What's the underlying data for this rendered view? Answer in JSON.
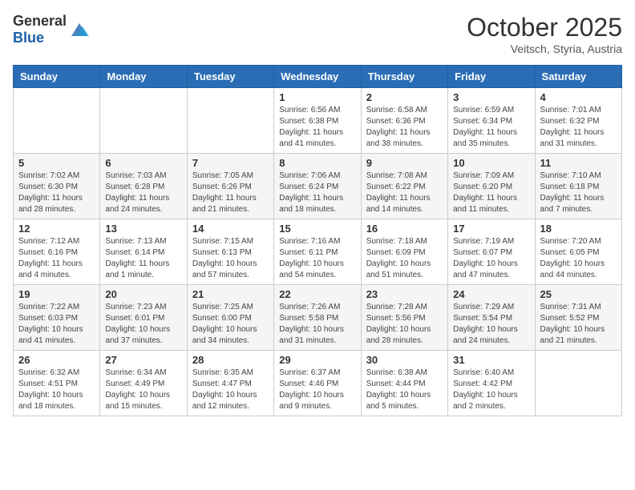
{
  "header": {
    "logo_general": "General",
    "logo_blue": "Blue",
    "month": "October 2025",
    "location": "Veitsch, Styria, Austria"
  },
  "weekdays": [
    "Sunday",
    "Monday",
    "Tuesday",
    "Wednesday",
    "Thursday",
    "Friday",
    "Saturday"
  ],
  "weeks": [
    [
      {
        "day": "",
        "info": ""
      },
      {
        "day": "",
        "info": ""
      },
      {
        "day": "",
        "info": ""
      },
      {
        "day": "1",
        "info": "Sunrise: 6:56 AM\nSunset: 6:38 PM\nDaylight: 11 hours\nand 41 minutes."
      },
      {
        "day": "2",
        "info": "Sunrise: 6:58 AM\nSunset: 6:36 PM\nDaylight: 11 hours\nand 38 minutes."
      },
      {
        "day": "3",
        "info": "Sunrise: 6:59 AM\nSunset: 6:34 PM\nDaylight: 11 hours\nand 35 minutes."
      },
      {
        "day": "4",
        "info": "Sunrise: 7:01 AM\nSunset: 6:32 PM\nDaylight: 11 hours\nand 31 minutes."
      }
    ],
    [
      {
        "day": "5",
        "info": "Sunrise: 7:02 AM\nSunset: 6:30 PM\nDaylight: 11 hours\nand 28 minutes."
      },
      {
        "day": "6",
        "info": "Sunrise: 7:03 AM\nSunset: 6:28 PM\nDaylight: 11 hours\nand 24 minutes."
      },
      {
        "day": "7",
        "info": "Sunrise: 7:05 AM\nSunset: 6:26 PM\nDaylight: 11 hours\nand 21 minutes."
      },
      {
        "day": "8",
        "info": "Sunrise: 7:06 AM\nSunset: 6:24 PM\nDaylight: 11 hours\nand 18 minutes."
      },
      {
        "day": "9",
        "info": "Sunrise: 7:08 AM\nSunset: 6:22 PM\nDaylight: 11 hours\nand 14 minutes."
      },
      {
        "day": "10",
        "info": "Sunrise: 7:09 AM\nSunset: 6:20 PM\nDaylight: 11 hours\nand 11 minutes."
      },
      {
        "day": "11",
        "info": "Sunrise: 7:10 AM\nSunset: 6:18 PM\nDaylight: 11 hours\nand 7 minutes."
      }
    ],
    [
      {
        "day": "12",
        "info": "Sunrise: 7:12 AM\nSunset: 6:16 PM\nDaylight: 11 hours\nand 4 minutes."
      },
      {
        "day": "13",
        "info": "Sunrise: 7:13 AM\nSunset: 6:14 PM\nDaylight: 11 hours\nand 1 minute."
      },
      {
        "day": "14",
        "info": "Sunrise: 7:15 AM\nSunset: 6:13 PM\nDaylight: 10 hours\nand 57 minutes."
      },
      {
        "day": "15",
        "info": "Sunrise: 7:16 AM\nSunset: 6:11 PM\nDaylight: 10 hours\nand 54 minutes."
      },
      {
        "day": "16",
        "info": "Sunrise: 7:18 AM\nSunset: 6:09 PM\nDaylight: 10 hours\nand 51 minutes."
      },
      {
        "day": "17",
        "info": "Sunrise: 7:19 AM\nSunset: 6:07 PM\nDaylight: 10 hours\nand 47 minutes."
      },
      {
        "day": "18",
        "info": "Sunrise: 7:20 AM\nSunset: 6:05 PM\nDaylight: 10 hours\nand 44 minutes."
      }
    ],
    [
      {
        "day": "19",
        "info": "Sunrise: 7:22 AM\nSunset: 6:03 PM\nDaylight: 10 hours\nand 41 minutes."
      },
      {
        "day": "20",
        "info": "Sunrise: 7:23 AM\nSunset: 6:01 PM\nDaylight: 10 hours\nand 37 minutes."
      },
      {
        "day": "21",
        "info": "Sunrise: 7:25 AM\nSunset: 6:00 PM\nDaylight: 10 hours\nand 34 minutes."
      },
      {
        "day": "22",
        "info": "Sunrise: 7:26 AM\nSunset: 5:58 PM\nDaylight: 10 hours\nand 31 minutes."
      },
      {
        "day": "23",
        "info": "Sunrise: 7:28 AM\nSunset: 5:56 PM\nDaylight: 10 hours\nand 28 minutes."
      },
      {
        "day": "24",
        "info": "Sunrise: 7:29 AM\nSunset: 5:54 PM\nDaylight: 10 hours\nand 24 minutes."
      },
      {
        "day": "25",
        "info": "Sunrise: 7:31 AM\nSunset: 5:52 PM\nDaylight: 10 hours\nand 21 minutes."
      }
    ],
    [
      {
        "day": "26",
        "info": "Sunrise: 6:32 AM\nSunset: 4:51 PM\nDaylight: 10 hours\nand 18 minutes."
      },
      {
        "day": "27",
        "info": "Sunrise: 6:34 AM\nSunset: 4:49 PM\nDaylight: 10 hours\nand 15 minutes."
      },
      {
        "day": "28",
        "info": "Sunrise: 6:35 AM\nSunset: 4:47 PM\nDaylight: 10 hours\nand 12 minutes."
      },
      {
        "day": "29",
        "info": "Sunrise: 6:37 AM\nSunset: 4:46 PM\nDaylight: 10 hours\nand 9 minutes."
      },
      {
        "day": "30",
        "info": "Sunrise: 6:38 AM\nSunset: 4:44 PM\nDaylight: 10 hours\nand 5 minutes."
      },
      {
        "day": "31",
        "info": "Sunrise: 6:40 AM\nSunset: 4:42 PM\nDaylight: 10 hours\nand 2 minutes."
      },
      {
        "day": "",
        "info": ""
      }
    ]
  ]
}
